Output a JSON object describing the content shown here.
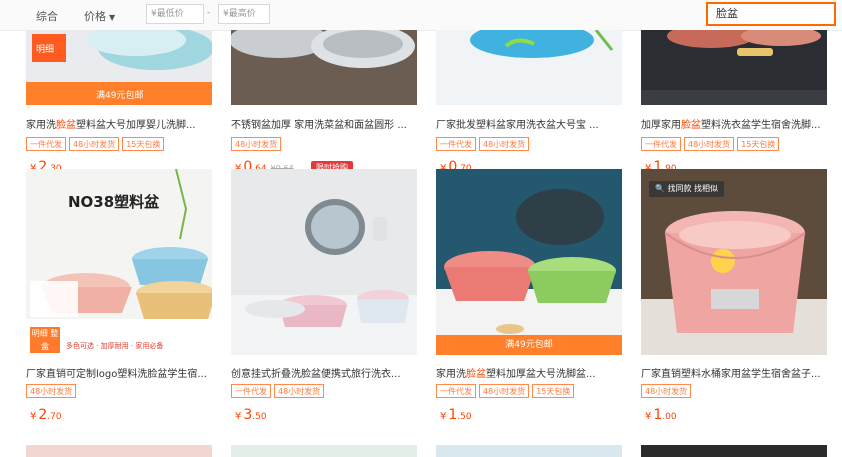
{
  "toolbar": {
    "sort_label": "综合",
    "price_label": "价格",
    "price_min_placeholder": "¥最低价",
    "price_max_placeholder": "¥最高价",
    "price_separator": "-",
    "search_value": "脸盆"
  },
  "row1": [
    {
      "title_pre": "家用洗",
      "title_kw": "脸盆",
      "title_post": "塑料盆大号加厚婴儿洗脚...",
      "image_label": "满49元包邮",
      "corner": "明细",
      "tags": [
        "一件代发",
        "48小时发货",
        "15天包换"
      ],
      "currency": "¥",
      "price_int": "2",
      "price_dec": ".30"
    },
    {
      "title_pre": "不锈钢盆加厚 家用洗菜盆和面盆圆形 ...",
      "title_kw": "",
      "title_post": "",
      "tags": [
        "48小时发货"
      ],
      "currency": "¥",
      "price_int": "0",
      "price_dec": ".64",
      "price_orig": "¥0.64",
      "badge": "限时抢购"
    },
    {
      "title_pre": "厂家批发塑料盆家用洗衣盆大号宝 ...",
      "title_kw": "",
      "title_post": "",
      "tags": [
        "一件代发",
        "48小时发货"
      ],
      "currency": "¥",
      "price_int": "0",
      "price_dec": ".70"
    },
    {
      "title_pre": "加厚家用",
      "title_kw": "脸盆",
      "title_post": "塑料洗衣盆学生宿舍洗脚...",
      "tags": [
        "一件代发",
        "48小时发货",
        "15天包换"
      ],
      "currency": "¥",
      "price_int": "1",
      "price_dec": ".90"
    }
  ],
  "row2": [
    {
      "title_pre": "厂家直销可定制logo塑料洗脸盆学生宿...",
      "title_kw": "",
      "title_post": "",
      "image_text": "NO38塑料盆",
      "corner": "明细 整盒",
      "banner": "多色可选 · 加厚耐用 · 家用必备",
      "tags": [
        "48小时发货"
      ],
      "currency": "¥",
      "price_int": "2",
      "price_dec": ".70"
    },
    {
      "title_pre": "创意挂式折叠洗脸盆便携式旅行洗衣...",
      "title_kw": "",
      "title_post": "",
      "tags": [
        "一件代发",
        "48小时发货"
      ],
      "currency": "¥",
      "price_int": "3",
      "price_dec": ".50"
    },
    {
      "title_pre": "家用洗",
      "title_kw": "脸盆",
      "title_post": "塑料加厚盆大号洗脚盆...",
      "image_label": "满49元包邮",
      "tags": [
        "一件代发",
        "48小时发货",
        "15天包换"
      ],
      "currency": "¥",
      "price_int": "1",
      "price_dec": ".50"
    },
    {
      "title_pre": "厂家直销塑料水桶家用盆学生宿舍盆子...",
      "title_kw": "",
      "title_post": "",
      "overlay": "找同款 找相似",
      "tags": [
        "48小时发货"
      ],
      "currency": "¥",
      "price_int": "1",
      "price_dec": ".00"
    }
  ],
  "colors": {
    "accent": "#ff4400",
    "tag_border": "#ff8a4c",
    "banner": "#ff7f2a",
    "search_border": "#ff6a00"
  }
}
